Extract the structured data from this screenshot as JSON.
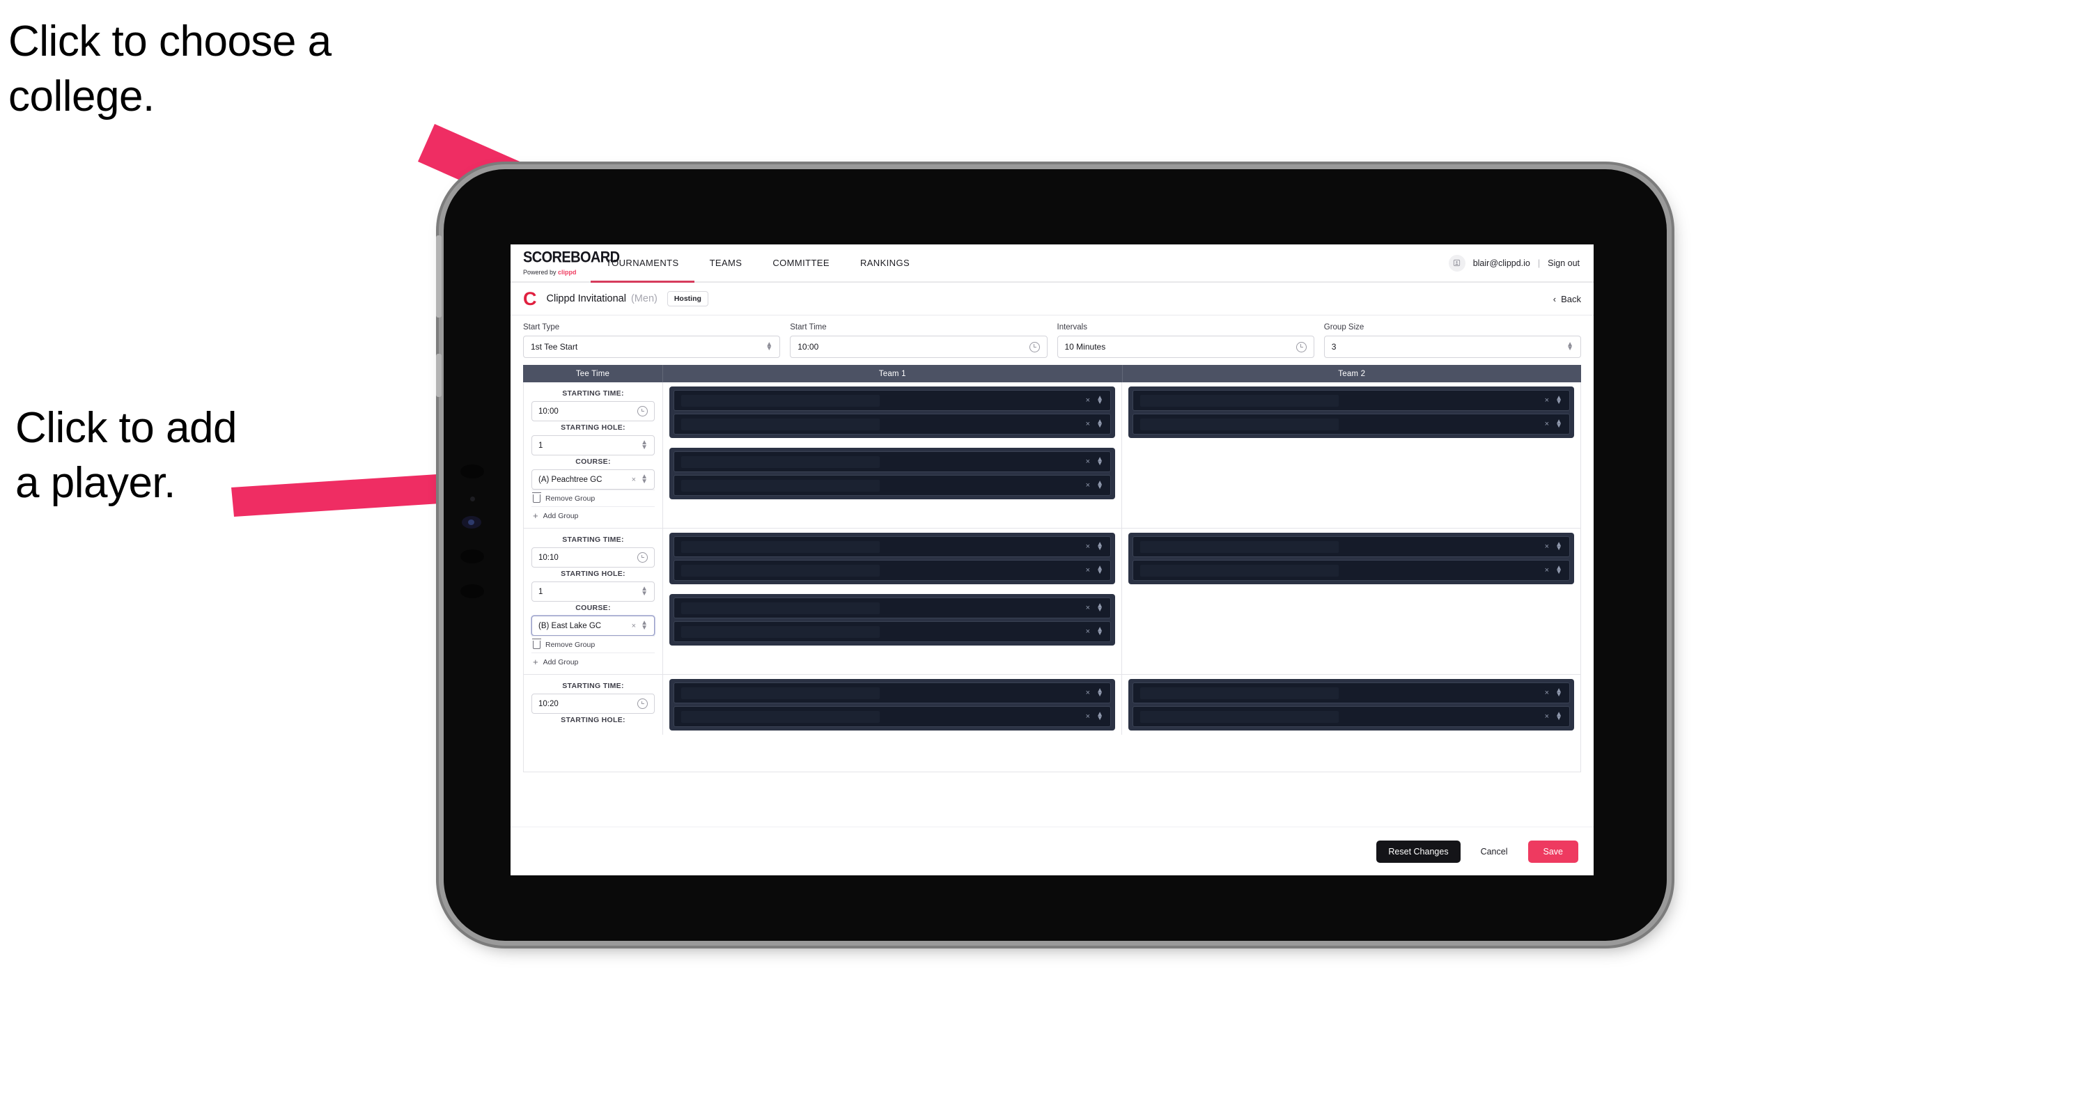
{
  "annotations": {
    "college": "Click to choose a\ncollege.",
    "player": "Click to add\na player.",
    "arrow_color": "#ef2d63"
  },
  "topnav": {
    "logo_word": "SCOREBOARD",
    "logo_sub_prefix": "Powered by ",
    "logo_sub_brand": "clippd",
    "tabs": [
      {
        "label": "TOURNAMENTS",
        "active": true
      },
      {
        "label": "TEAMS",
        "active": false
      },
      {
        "label": "COMMITTEE",
        "active": false
      },
      {
        "label": "RANKINGS",
        "active": false
      }
    ],
    "avatar_icon": "user-glyph",
    "user_email": "blair@clippd.io",
    "separator": "|",
    "sign_out": "Sign out"
  },
  "tournament_bar": {
    "logo_letter": "C",
    "name": "Clippd Invitational",
    "gender": "(Men)",
    "badge": "Hosting",
    "back_chevron": "‹",
    "back_label": "Back"
  },
  "controls": [
    {
      "label": "Start Type",
      "value": "1st Tee Start",
      "icon": "stepper-icon"
    },
    {
      "label": "Start Time",
      "value": "10:00",
      "icon": "clock-icon"
    },
    {
      "label": "Intervals",
      "value": "10 Minutes",
      "icon": "clock-icon"
    },
    {
      "label": "Group Size",
      "value": "3",
      "icon": "stepper-icon"
    }
  ],
  "table": {
    "headers": {
      "tee_time": "Tee Time",
      "team1": "Team 1",
      "team2": "Team 2"
    },
    "field_labels": {
      "starting_time": "STARTING TIME:",
      "starting_hole": "STARTING HOLE:",
      "course": "COURSE:"
    },
    "actions": {
      "remove_group": "Remove Group",
      "add_group": "Add Group"
    },
    "groups": [
      {
        "starting_time": "10:00",
        "starting_hole": "1",
        "course": "(A) Peachtree GC",
        "course_focused": false,
        "team1_blocks": [
          2,
          2
        ],
        "team2_blocks": [
          2
        ]
      },
      {
        "starting_time": "10:10",
        "starting_hole": "1",
        "course": "(B) East Lake GC",
        "course_focused": true,
        "team1_blocks": [
          2,
          2
        ],
        "team2_blocks": [
          2
        ]
      },
      {
        "starting_time": "10:20",
        "starting_hole": "",
        "course": "",
        "course_focused": false,
        "team1_blocks": [
          2
        ],
        "team2_blocks": [
          2
        ]
      }
    ],
    "row_icons": {
      "clear": "×",
      "stepper": "stepper-icon"
    }
  },
  "footer": {
    "reset": "Reset Changes",
    "cancel": "Cancel",
    "save": "Save"
  }
}
